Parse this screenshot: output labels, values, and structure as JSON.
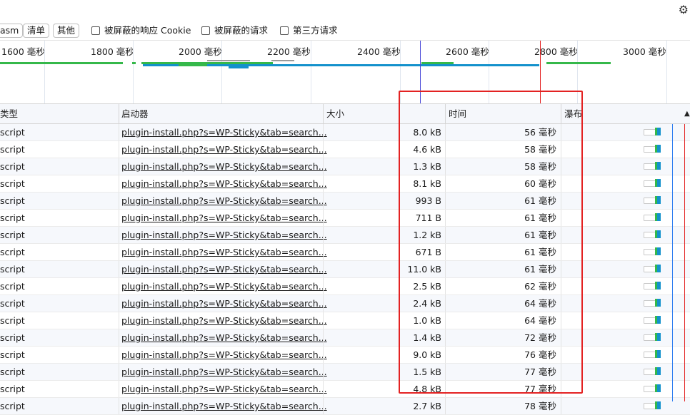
{
  "filters": {
    "buttons": [
      "asm",
      "清单",
      "其他"
    ],
    "checkboxes": [
      "被屏蔽的响应 Cookie",
      "被屏蔽的请求",
      "第三方请求"
    ]
  },
  "timeline": {
    "ticks": [
      "1600 毫秒",
      "1800 毫秒",
      "2000 毫秒",
      "2200 毫秒",
      "2400 毫秒",
      "2600 毫秒",
      "2800 毫秒",
      "3000 毫秒"
    ]
  },
  "table": {
    "headers": {
      "type": "类型",
      "initiator": "启动器",
      "size": "大小",
      "time": "时间",
      "waterfall": "瀑布"
    },
    "rows": [
      {
        "type": "script",
        "initiator": "plugin-install.php?s=WP-Sticky&tab=search...",
        "size": "8.0 kB",
        "time": "56 毫秒"
      },
      {
        "type": "script",
        "initiator": "plugin-install.php?s=WP-Sticky&tab=search...",
        "size": "4.6 kB",
        "time": "58 毫秒"
      },
      {
        "type": "script",
        "initiator": "plugin-install.php?s=WP-Sticky&tab=search...",
        "size": "1.3 kB",
        "time": "58 毫秒"
      },
      {
        "type": "script",
        "initiator": "plugin-install.php?s=WP-Sticky&tab=search...",
        "size": "8.1 kB",
        "time": "60 毫秒"
      },
      {
        "type": "script",
        "initiator": "plugin-install.php?s=WP-Sticky&tab=search...",
        "size": "993 B",
        "time": "61 毫秒"
      },
      {
        "type": "script",
        "initiator": "plugin-install.php?s=WP-Sticky&tab=search...",
        "size": "711 B",
        "time": "61 毫秒"
      },
      {
        "type": "script",
        "initiator": "plugin-install.php?s=WP-Sticky&tab=search...",
        "size": "1.2 kB",
        "time": "61 毫秒"
      },
      {
        "type": "script",
        "initiator": "plugin-install.php?s=WP-Sticky&tab=search...",
        "size": "671 B",
        "time": "61 毫秒"
      },
      {
        "type": "script",
        "initiator": "plugin-install.php?s=WP-Sticky&tab=search...",
        "size": "11.0 kB",
        "time": "61 毫秒"
      },
      {
        "type": "script",
        "initiator": "plugin-install.php?s=WP-Sticky&tab=search...",
        "size": "2.5 kB",
        "time": "62 毫秒"
      },
      {
        "type": "script",
        "initiator": "plugin-install.php?s=WP-Sticky&tab=search...",
        "size": "2.4 kB",
        "time": "64 毫秒"
      },
      {
        "type": "script",
        "initiator": "plugin-install.php?s=WP-Sticky&tab=search...",
        "size": "1.0 kB",
        "time": "64 毫秒"
      },
      {
        "type": "script",
        "initiator": "plugin-install.php?s=WP-Sticky&tab=search...",
        "size": "1.4 kB",
        "time": "72 毫秒"
      },
      {
        "type": "script",
        "initiator": "plugin-install.php?s=WP-Sticky&tab=search...",
        "size": "9.0 kB",
        "time": "76 毫秒"
      },
      {
        "type": "script",
        "initiator": "plugin-install.php?s=WP-Sticky&tab=search...",
        "size": "1.5 kB",
        "time": "77 毫秒"
      },
      {
        "type": "script",
        "initiator": "plugin-install.php?s=WP-Sticky&tab=search...",
        "size": "4.8 kB",
        "time": "77 毫秒"
      },
      {
        "type": "script",
        "initiator": "plugin-install.php?s=WP-Sticky&tab=search...",
        "size": "2.7 kB",
        "time": "78 毫秒"
      }
    ]
  }
}
